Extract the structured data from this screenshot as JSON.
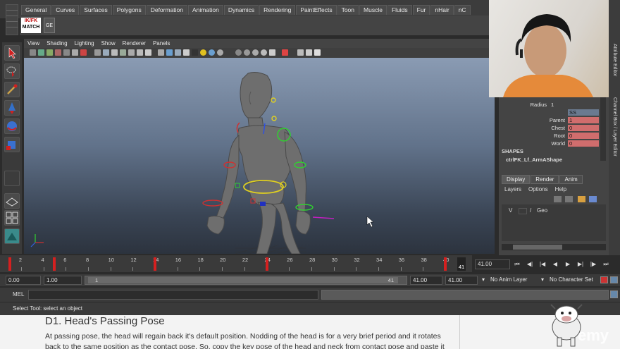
{
  "shelf": {
    "tabs": [
      "General",
      "Curves",
      "Surfaces",
      "Polygons",
      "Deformation",
      "Animation",
      "Dynamics",
      "Rendering",
      "PaintEffects",
      "Toon",
      "Muscle",
      "Fluids",
      "Fur",
      "nHair",
      "nC"
    ],
    "icon_ikfk_top": "IK/FK",
    "icon_ikfk_bottom": "MATCH",
    "icon_ge": "GE"
  },
  "viewport": {
    "menus": [
      "View",
      "Shading",
      "Lighting",
      "Show",
      "Renderer",
      "Panels"
    ],
    "axis": {
      "x": "x",
      "y": "y",
      "z": "z"
    }
  },
  "timeline": {
    "ticks": [
      "2",
      "4",
      "6",
      "8",
      "10",
      "12",
      "14",
      "16",
      "18",
      "20",
      "22",
      "24",
      "26",
      "28",
      "30",
      "32",
      "34",
      "36",
      "38",
      "40"
    ],
    "current_frame": "41",
    "current_time": "41.00",
    "keys": [
      1,
      5,
      14,
      24,
      40
    ]
  },
  "range": {
    "start_time": "0.00",
    "start_range": "1.00",
    "range_min": "1",
    "range_max": "41",
    "end_range": "41.00",
    "end_time": "41.00",
    "anim_layer": "No Anim Layer",
    "character_set": "No Character Set"
  },
  "mel": {
    "label": "MEL"
  },
  "help": {
    "text": "Select Tool: select an object"
  },
  "document": {
    "title": "D1. Head's Passing Pose",
    "body": "At passing pose, the head will regain back it's default position. Nodding of the head is for a very brief period and it rotates back to the same position as the contact pose. So, copy the key pose of the head and neck from contact pose and paste it"
  },
  "channel_box": {
    "rows": [
      {
        "name": "Radius",
        "value": "1"
      },
      {
        "name": "",
        "value": "SS"
      },
      {
        "name": "Parent",
        "value": "1"
      },
      {
        "name": "Chest",
        "value": "0"
      },
      {
        "name": "Root",
        "value": "0"
      },
      {
        "name": "World",
        "value": "0"
      }
    ],
    "shapes_label": "SHAPES",
    "shape_name": "ctrlFK_Lf_ArmAShape"
  },
  "layer_editor": {
    "tabs": [
      "Display",
      "Render",
      "Anim"
    ],
    "menus": [
      "Layers",
      "Options",
      "Help"
    ],
    "layer": {
      "visible": "V",
      "name": "Geo"
    }
  },
  "side_tabs": [
    "Attribute Editor",
    "Channel Box / Layer Editor"
  ],
  "brand": "emy",
  "colors": {
    "key": "#d42020",
    "channel": "#d06d6d"
  }
}
